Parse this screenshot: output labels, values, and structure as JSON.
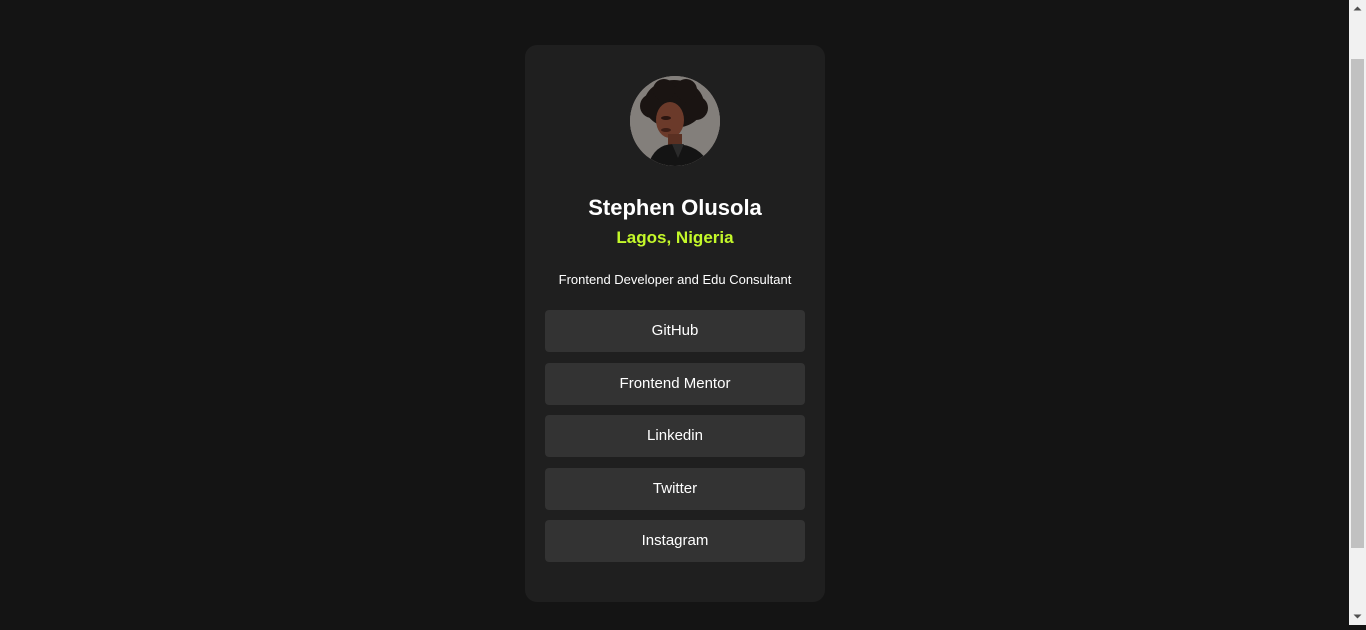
{
  "profile": {
    "name": "Stephen Olusola",
    "location": "Lagos, Nigeria",
    "bio": "Frontend Developer and Edu Consultant",
    "avatar_icon": "profile-photo"
  },
  "links": [
    {
      "label": "GitHub"
    },
    {
      "label": "Frontend Mentor"
    },
    {
      "label": "Linkedin"
    },
    {
      "label": "Twitter"
    },
    {
      "label": "Instagram"
    }
  ],
  "colors": {
    "background": "#141414",
    "card": "#1f1f1f",
    "button": "#333333",
    "accent": "#c4f82a",
    "text": "#ffffff"
  }
}
